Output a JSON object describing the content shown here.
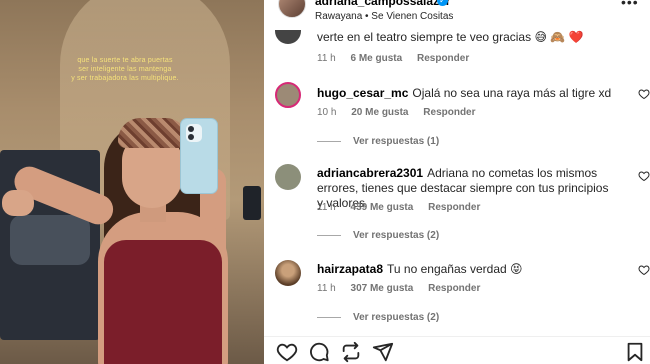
{
  "video": {
    "caption_lines": [
      "que la suerte te abra puertas",
      "ser inteligente las mantenga",
      "y ser trabajadora las multiplique."
    ]
  },
  "post": {
    "username": "adriana_campossalazar",
    "audio": "Rawayana • Se Vienen Cositas",
    "more_icon": "more-icon"
  },
  "comments": [
    {
      "username": "",
      "text": "verte en el teatro siempre te veo gracias 😅 🙈 ❤️",
      "time": "11 h",
      "likes": "6 Me gusta",
      "reply": "Responder",
      "avatar_color": "#555555"
    },
    {
      "username": "hugo_cesar_mc",
      "text": "Ojalá no sea una raya más al tigre xd",
      "time": "10 h",
      "likes": "20 Me gusta",
      "reply": "Responder",
      "view_replies": "Ver respuestas (1)",
      "avatar_color": "#9c8a76"
    },
    {
      "username": "adriancabrera2301",
      "text": "Adriana no cometas los mismos errores, tienes que destacar siempre con tus principios y valores",
      "time": "11 h",
      "likes": "439 Me gusta",
      "reply": "Responder",
      "view_replies": "Ver respuestas (2)",
      "avatar_color": "#8c8f7a"
    },
    {
      "username": "hairzapata8",
      "text": "Tu no engañas verdad 😝",
      "time": "11 h",
      "likes": "307 Me gusta",
      "reply": "Responder",
      "view_replies": "Ver respuestas (2)",
      "avatar_color": "#7a5a3e"
    }
  ],
  "actions": [
    "heart-icon",
    "comment-icon",
    "share-repost-icon",
    "send-icon",
    "bookmark-icon"
  ],
  "colors": {
    "text": "#262626",
    "muted": "#737373",
    "verified": "#0095f6",
    "story_ring": "#d62976"
  }
}
